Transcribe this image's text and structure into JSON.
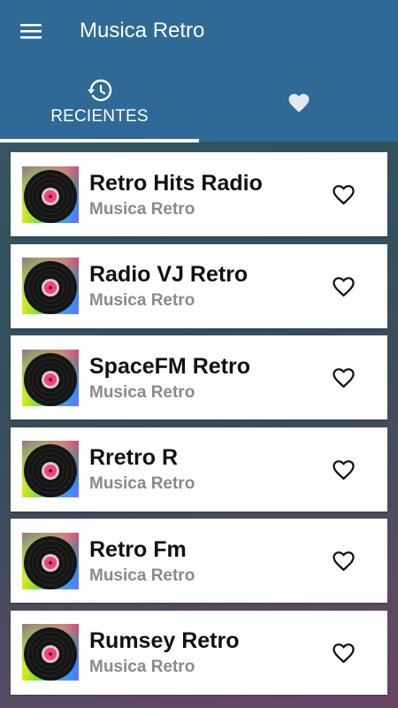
{
  "app": {
    "title": "Musica Retro",
    "colors": {
      "toolbar": "#2f6a96",
      "card": "#ffffff",
      "title_text": "#111111",
      "subtitle_text": "#8a8a8a"
    }
  },
  "tabs": [
    {
      "label": "RECIENTES",
      "icon": "history-icon",
      "selected": true
    },
    {
      "label": "",
      "icon": "heart-icon",
      "selected": false
    }
  ],
  "stations": [
    {
      "name": "Retro Hits Radio",
      "subtitle": "Musica Retro",
      "favorite": false
    },
    {
      "name": "Radio VJ Retro",
      "subtitle": "Musica Retro",
      "favorite": false
    },
    {
      "name": "SpaceFM Retro",
      "subtitle": "Musica Retro",
      "favorite": false
    },
    {
      "name": "Rretro R",
      "subtitle": "Musica Retro",
      "favorite": false
    },
    {
      "name": "Retro Fm",
      "subtitle": "Musica Retro",
      "favorite": false
    },
    {
      "name": "Rumsey Retro",
      "subtitle": "Musica Retro",
      "favorite": false
    }
  ]
}
